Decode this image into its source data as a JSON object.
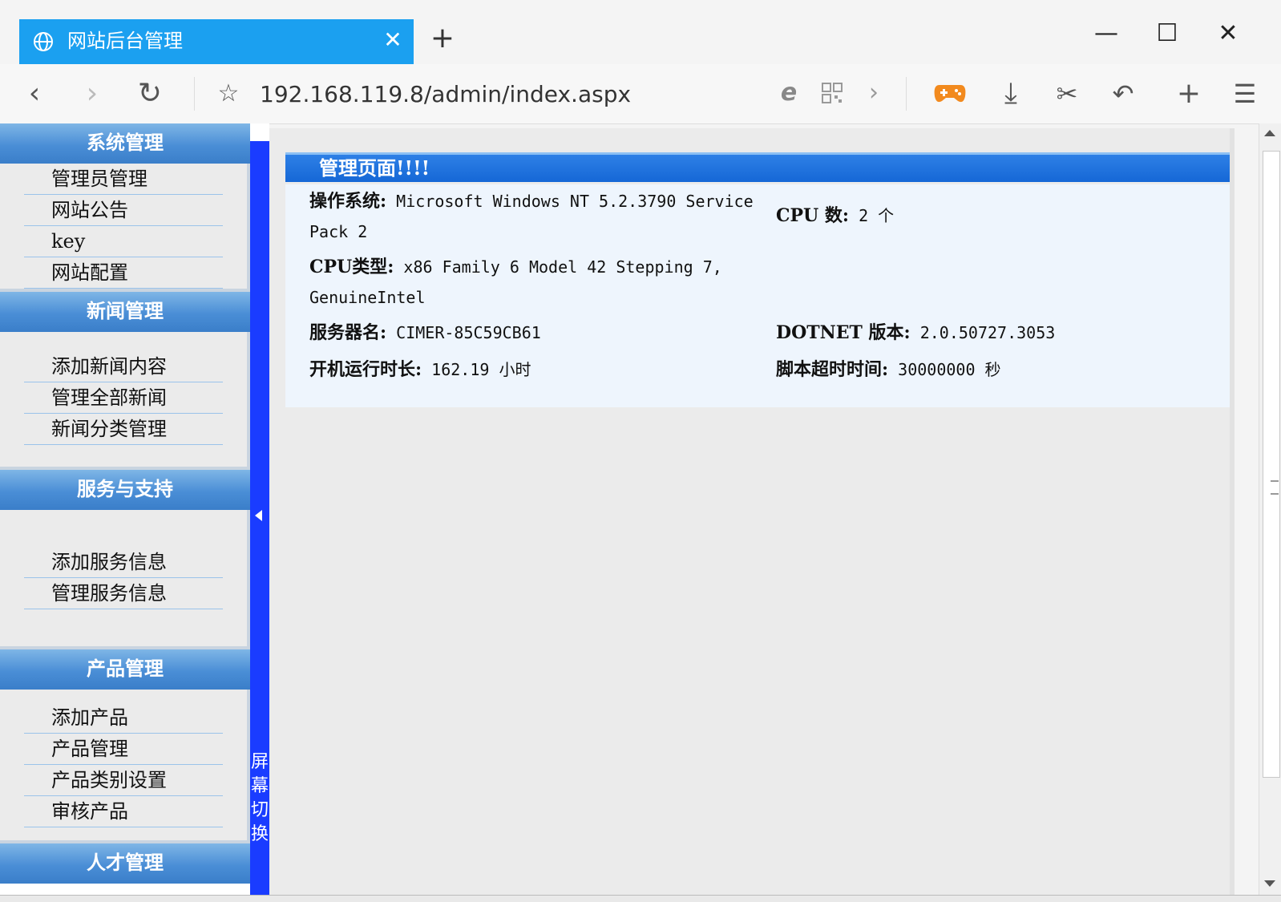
{
  "browser": {
    "tab_title": "网站后台管理",
    "tab_close": "✕",
    "new_tab": "+",
    "minimize": "—",
    "maximize": "☐",
    "close": "✕",
    "url": "192.168.119.8/admin/index.aspx",
    "toolbar_icons": [
      "back-icon",
      "forward-icon",
      "reload-icon",
      "star-icon",
      "ie-icon",
      "qr-icon",
      "chevron-right-icon",
      "gamepad-icon",
      "download-icon",
      "scissors-icon",
      "undo-icon",
      "plus-icon",
      "menu-icon"
    ],
    "accent_color": "#1ba0f0"
  },
  "sidebar": {
    "sections": [
      {
        "title": "系统管理",
        "items": [
          "管理员管理",
          "网站公告",
          "key",
          "网站配置"
        ]
      },
      {
        "title": "新闻管理",
        "items": [
          "添加新闻内容",
          "管理全部新闻",
          "新闻分类管理"
        ]
      },
      {
        "title": "服务与支持",
        "items": [
          "添加服务信息",
          "管理服务信息"
        ]
      },
      {
        "title": "产品管理",
        "items": [
          "添加产品",
          "产品管理",
          "产品类别设置",
          "审核产品"
        ]
      },
      {
        "title": "人才管理",
        "items": []
      }
    ]
  },
  "splitter": {
    "label": "屏幕切换"
  },
  "panel": {
    "title": "管理页面!!!!",
    "os_label": "操作系统:",
    "os_value_1": "Microsoft Windows NT 5.2.3790 Service",
    "os_value_2": "Pack 2",
    "cpu_count_label": "CPU 数:",
    "cpu_count_value": "2 个",
    "cpu_type_label": "CPU类型:",
    "cpu_type_value_1": "x86 Family 6 Model 42 Stepping 7,",
    "cpu_type_value_2": "GenuineIntel",
    "server_label": "服务器名:",
    "server_value": "CIMER-85C59CB61",
    "dotnet_label": "DOTNET 版本:",
    "dotnet_value": "2.0.50727.3053",
    "uptime_label": "开机运行时长:",
    "uptime_value": "162.19 小时",
    "timeout_label": "脚本超时时间:",
    "timeout_value": "30000000 秒"
  }
}
